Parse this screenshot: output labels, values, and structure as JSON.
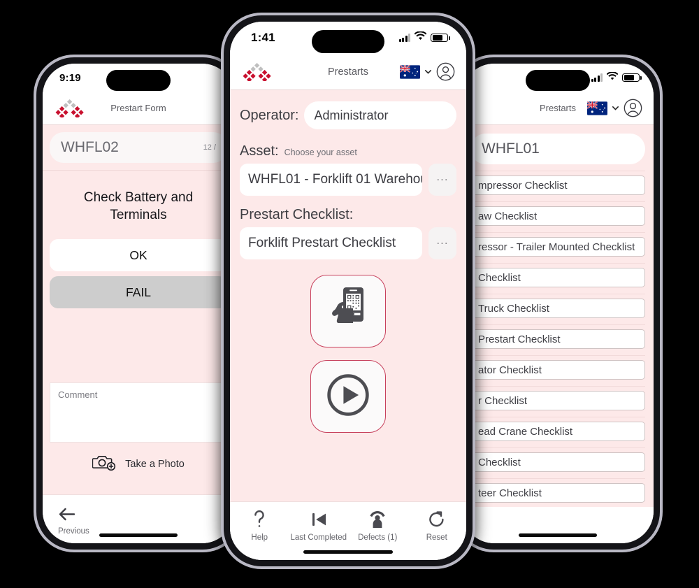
{
  "app": {
    "brand_red": "#c8102e",
    "brand_grey": "#bfbfbf",
    "page_bg": "#fde9e9",
    "accent_border": "#c7405c"
  },
  "phone_left": {
    "status": {
      "time": "9:19"
    },
    "header": {
      "title": "Prestart Form",
      "logo_icon": "diamond-cluster-logo"
    },
    "search": {
      "value": "WHFL02",
      "counter": "12 / "
    },
    "question": "Check Battery and Terminals",
    "choices": [
      {
        "label": "OK",
        "state": "unselected"
      },
      {
        "label": "FAIL",
        "state": "selected"
      }
    ],
    "comment": {
      "placeholder": "Comment",
      "value": ""
    },
    "photo": {
      "label": "Take a Photo",
      "icon": "camera-plus-icon"
    },
    "nav": [
      {
        "label": "Previous",
        "icon": "arrow-left-icon"
      }
    ]
  },
  "phone_center": {
    "status": {
      "time": "1:41",
      "signal_icon": "cellular-signal-icon",
      "wifi_icon": "wifi-icon",
      "battery_icon": "battery-icon"
    },
    "header": {
      "title": "Prestarts",
      "logo_icon": "diamond-cluster-logo",
      "flag_icon": "australia-flag-icon",
      "chevron_icon": "chevron-down-icon",
      "avatar_icon": "user-avatar-icon"
    },
    "operator": {
      "label": "Operator:",
      "value": "Administrator"
    },
    "asset": {
      "label": "Asset:",
      "hint": "Choose your asset",
      "value": "WHFL01 - Forklift 01 Warehou...",
      "picker_label": "..."
    },
    "checklist": {
      "label": "Prestart Checklist:",
      "value": "Forklift Prestart Checklist",
      "picker_label": "..."
    },
    "actions": [
      {
        "name": "scan-qr-button",
        "icon": "hand-holding-phone-qr-icon"
      },
      {
        "name": "start-button",
        "icon": "play-circle-icon"
      }
    ],
    "tabs": [
      {
        "label": "Help",
        "icon": "question-mark-icon"
      },
      {
        "label": "Last Completed",
        "icon": "skip-back-icon"
      },
      {
        "label": "Defects (1)",
        "icon": "person-defect-icon"
      },
      {
        "label": "Reset",
        "icon": "refresh-icon"
      }
    ]
  },
  "phone_right": {
    "status": {
      "signal_icon": "cellular-signal-icon",
      "wifi_icon": "wifi-icon",
      "battery_icon": "battery-icon"
    },
    "header": {
      "title": "Prestarts",
      "flag_icon": "australia-flag-icon",
      "chevron_icon": "chevron-down-icon",
      "avatar_icon": "user-avatar-icon"
    },
    "search": {
      "value": "WHFL01"
    },
    "list": [
      "mpressor Checklist",
      "aw Checklist",
      "ressor - Trailer Mounted Checklist",
      "Checklist",
      "Truck Checklist",
      " Prestart Checklist",
      "ator Checklist",
      "r Checklist",
      "ead Crane Checklist",
      "Checklist",
      "teer Checklist"
    ]
  }
}
